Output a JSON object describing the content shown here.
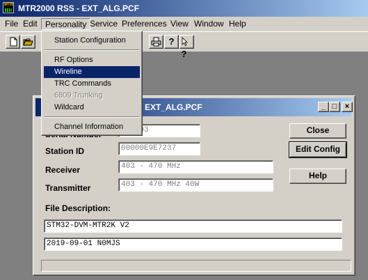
{
  "app": {
    "title": "MTR2000 RSS - EXT_ALG.PCF",
    "icon_label": "MTR"
  },
  "menubar": {
    "items": [
      "File",
      "Edit",
      "Personality",
      "Service",
      "Preferences",
      "View",
      "Window",
      "Help"
    ],
    "open_menu": "Personality"
  },
  "toolbar": {
    "buttons": [
      "new-icon",
      "open-icon",
      "print-icon",
      "help-icon",
      "context-help-icon"
    ],
    "help_glyph": "?",
    "context_help_glyph": "?"
  },
  "personality_menu": {
    "station_configuration": "Station Configuration",
    "rf_options": "RF Options",
    "wireline": "Wireline",
    "trc_commands": "TRC Commands",
    "trunking_6809": "6809 Trunking",
    "wildcard": "Wildcard",
    "channel_information": "Channel Information",
    "selected": "Wireline"
  },
  "dialog": {
    "title": "EXT_ALG.PCF",
    "serial_number_label": "Serial Number",
    "serial_number_value": "GK0393",
    "station_id_label": "Station ID",
    "station_id_value": "00000E9E7237",
    "receiver_label": "Receiver",
    "receiver_value": "403 - 470 MHz",
    "transmitter_label": "Transmitter",
    "transmitter_value": "403 - 470 MHz  40W",
    "file_description_label": "File Description:",
    "description_line1": "STM32-DVM-MTR2K V2",
    "description_line2": "2019-09-01 N0MJS",
    "close_label": "Close",
    "edit_config_label": "Edit Config",
    "help_label": "Help",
    "minimize_glyph": "_",
    "maximize_glyph": "□",
    "close_glyph": "×"
  }
}
